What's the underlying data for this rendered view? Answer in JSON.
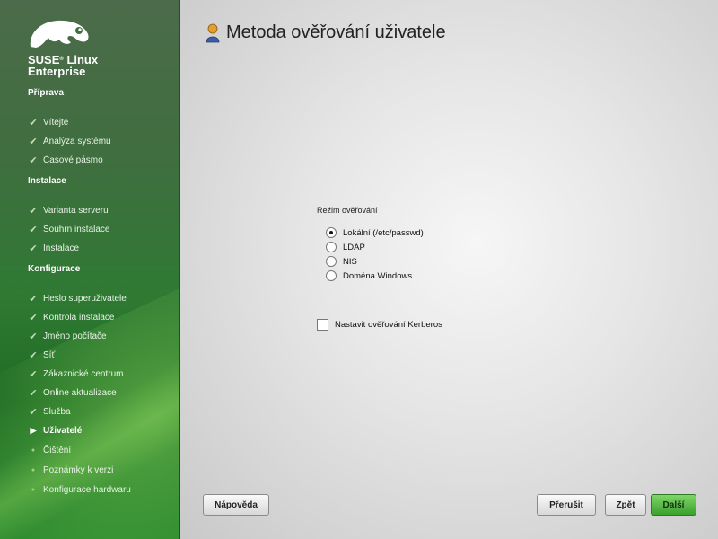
{
  "brand": {
    "line1": "SUSE",
    "reg": "®",
    "line1b": " Linux",
    "line2": "Enterprise"
  },
  "sections": [
    {
      "title": "Příprava",
      "items": [
        "Vítejte",
        "Analýza systému",
        "Časové pásmo"
      ]
    },
    {
      "title": "Instalace",
      "items": [
        "Varianta serveru",
        "Souhrn instalace",
        "Instalace"
      ]
    },
    {
      "title": "Konfigurace",
      "items": [
        "Heslo superuživatele",
        "Kontrola instalace",
        "Jméno počítače",
        "Síť",
        "Zákaznické centrum",
        "Online aktualizace",
        "Služba",
        "Uživatelé",
        "Čištění",
        "Poznámky k verzi",
        "Konfigurace hardwaru"
      ]
    }
  ],
  "current_step": "Uživatelé",
  "page": {
    "title": "Metoda ověřování uživatele"
  },
  "auth": {
    "group_label": "Režim ověřování",
    "options": [
      "Lokální (/etc/passwd)",
      "LDAP",
      "NIS",
      "Doména Windows"
    ],
    "selected": "Lokální (/etc/passwd)",
    "kerberos_label": "Nastavit ověřování Kerberos",
    "kerberos_checked": false
  },
  "buttons": {
    "help": "Nápověda",
    "abort": "Přerušit",
    "back": "Zpět",
    "next": "Další"
  },
  "colors": {
    "accent": "#3aa02c",
    "sidebar": "#2f7a33"
  }
}
